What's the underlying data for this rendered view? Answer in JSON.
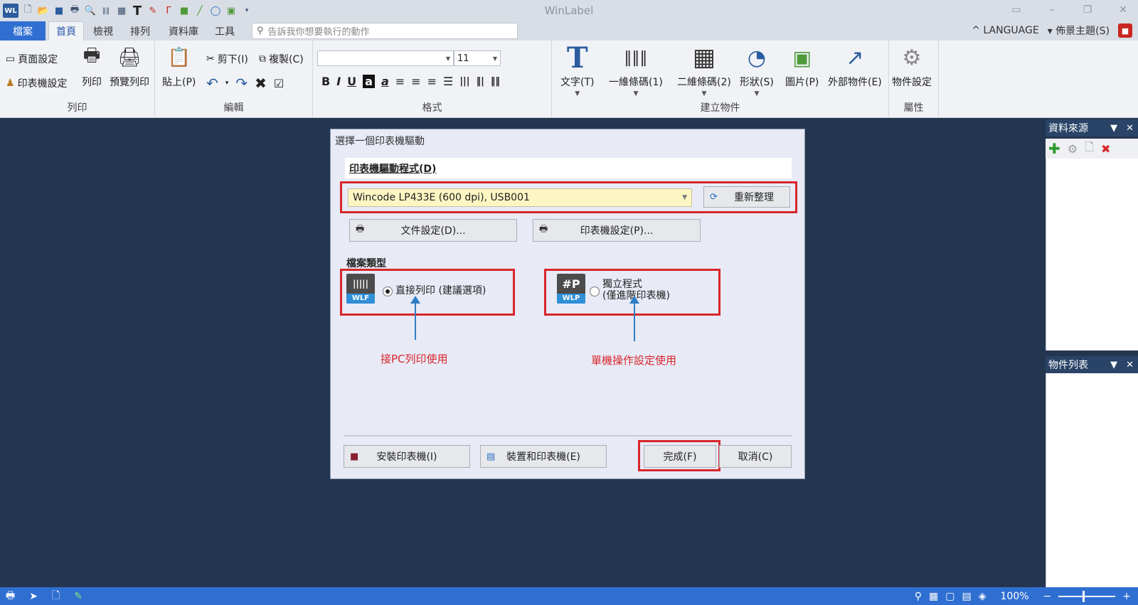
{
  "app": {
    "title": "WinLabel",
    "logo_text": "WL"
  },
  "quick_access": [
    {
      "icon": "new-file-icon",
      "glyph": "🗋"
    },
    {
      "icon": "open-folder-icon",
      "glyph": "📂"
    },
    {
      "icon": "save-icon",
      "glyph": "💾"
    },
    {
      "icon": "print-icon",
      "glyph": "🖶"
    },
    {
      "icon": "preview-icon",
      "glyph": "🔍"
    },
    {
      "icon": "barcode-icon",
      "glyph": "|||"
    },
    {
      "icon": "qrcode-icon",
      "glyph": "▦"
    },
    {
      "icon": "text-icon",
      "glyph": "T"
    },
    {
      "icon": "edit-icon",
      "glyph": "✎"
    },
    {
      "icon": "line-icon",
      "glyph": "Γ"
    },
    {
      "icon": "rectangle-icon",
      "glyph": "■"
    },
    {
      "icon": "diagonal-line-icon",
      "glyph": "╱"
    },
    {
      "icon": "ellipse-icon",
      "glyph": "◯"
    },
    {
      "icon": "image-icon",
      "glyph": "▣"
    }
  ],
  "tabs": {
    "file": "檔案",
    "home": "首頁",
    "view": "檢視",
    "arrange": "排列",
    "database": "資料庫",
    "tools": "工具"
  },
  "tell_me": {
    "placeholder": "告訴我你想要執行的動作"
  },
  "header_right": {
    "language": "LANGUAGE",
    "theme": "佈景主題(S)"
  },
  "ribbon": {
    "print_group": {
      "label": "列印",
      "page_setup": "頁面設定",
      "printer_setup": "印表機設定",
      "print": "列印",
      "preview": "預覽列印"
    },
    "edit_group": {
      "label": "編輯",
      "paste": "貼上(P)",
      "cut": "剪下(I)",
      "copy": "複製(C)"
    },
    "format_group": {
      "label": "格式",
      "font_name": "",
      "font_size": "11"
    },
    "create_group": {
      "label": "建立物件",
      "text": "文字(T)",
      "barcode_1d": "一維條碼(1)",
      "barcode_2d": "二維條碼(2)",
      "shape": "形狀(S)",
      "picture": "圖片(P)",
      "external": "外部物件(E)"
    },
    "property_group": {
      "label": "屬性",
      "object_settings": "物件設定"
    }
  },
  "panels": {
    "datasource": "資料來源",
    "objects": "物件列表"
  },
  "dialog": {
    "title": "選擇一個印表機驅動",
    "driver_section": "印表機驅動程式(D)",
    "driver_value": "Wincode LP433E (600 dpi),  USB001",
    "refresh": "重新整理",
    "doc_settings": "文件設定(D)...",
    "printer_settings": "印表機設定(P)...",
    "file_type": "檔案類型",
    "option_wlf": {
      "icon_top": "|||||",
      "icon_band": "WLF",
      "label": "直接列印 (建議選項)",
      "selected": true
    },
    "option_wlp": {
      "icon_top": "#P",
      "icon_band": "WLP",
      "label_line1": "獨立程式",
      "label_line2": "(僅進階印表機)",
      "selected": false
    },
    "annotation_left": "接PC列印使用",
    "annotation_right": "單機操作設定使用",
    "install_printer": "安裝印表機(I)",
    "devices_printers": "裝置和印表機(E)",
    "finish": "完成(F)",
    "cancel": "取消(C)"
  },
  "statusbar": {
    "zoom": "100%"
  },
  "colors": {
    "accent": "#2f6fd1",
    "highlight_box": "#d8262b",
    "arrow": "#2d7ec6",
    "background": "#243550"
  }
}
